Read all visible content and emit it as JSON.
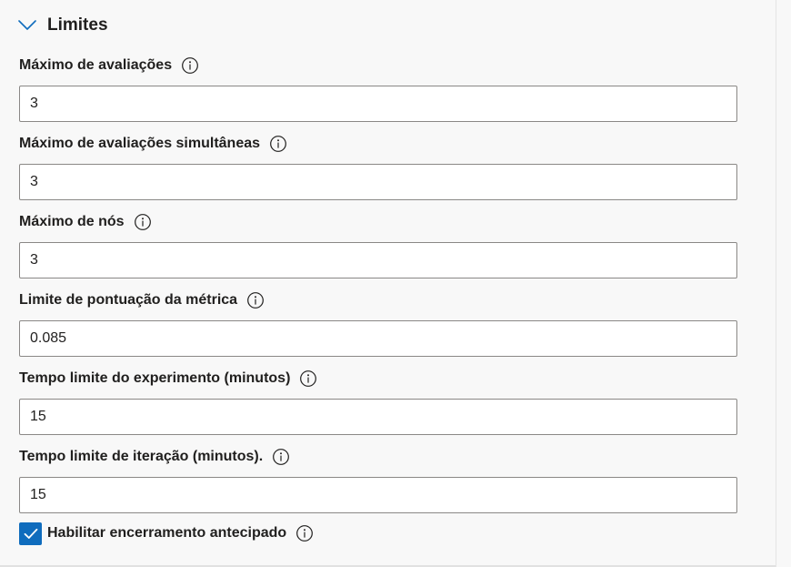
{
  "section": {
    "title": "Limites",
    "expanded": true
  },
  "fields": [
    {
      "label": "Máximo de avaliações",
      "value": "3"
    },
    {
      "label": "Máximo de avaliações simultâneas",
      "value": "3"
    },
    {
      "label": "Máximo de nós",
      "value": "3"
    },
    {
      "label": "Limite de pontuação da métrica",
      "value": "0.085"
    },
    {
      "label": "Tempo limite do experimento (minutos)",
      "value": "15"
    },
    {
      "label": "Tempo limite de iteração (minutos).",
      "value": "15"
    }
  ],
  "early_termination": {
    "label": "Habilitar encerramento antecipado",
    "checked": true
  },
  "colors": {
    "accent": "#0f6cbd",
    "background": "#f8f8f8",
    "input_border": "#8a8886",
    "text": "#201f1e"
  }
}
